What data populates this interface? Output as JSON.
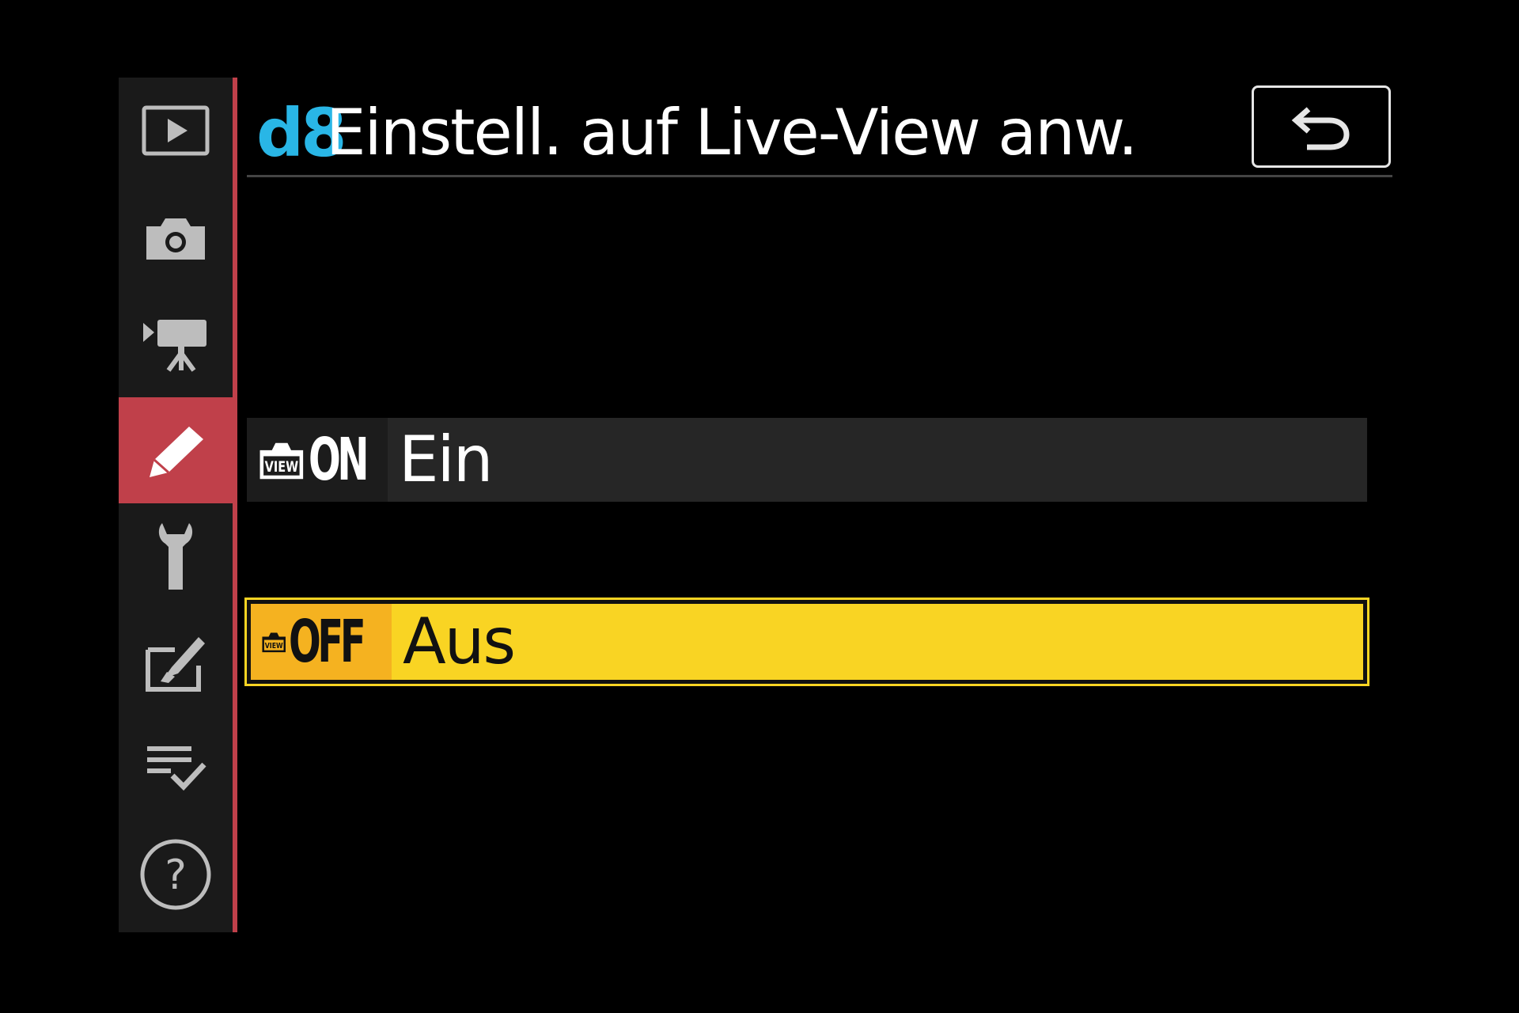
{
  "header": {
    "code": "d8",
    "title": "Einstell. auf Live-View anw."
  },
  "sidebar": {
    "items": [
      {
        "icon": "playback-icon"
      },
      {
        "icon": "camera-icon"
      },
      {
        "icon": "movie-icon"
      },
      {
        "icon": "pencil-icon",
        "active": true
      },
      {
        "icon": "wrench-icon"
      },
      {
        "icon": "retouch-icon"
      },
      {
        "icon": "my-menu-icon"
      },
      {
        "icon": "help-icon"
      }
    ]
  },
  "options": [
    {
      "code": "ON",
      "label": "Ein",
      "selected": false
    },
    {
      "code": "OFF",
      "label": "Aus",
      "selected": true
    }
  ],
  "colors": {
    "accent": "#c0404a",
    "code": "#29b6e6",
    "highlight": "#f9d423",
    "highlight_icon": "#f5b220"
  }
}
